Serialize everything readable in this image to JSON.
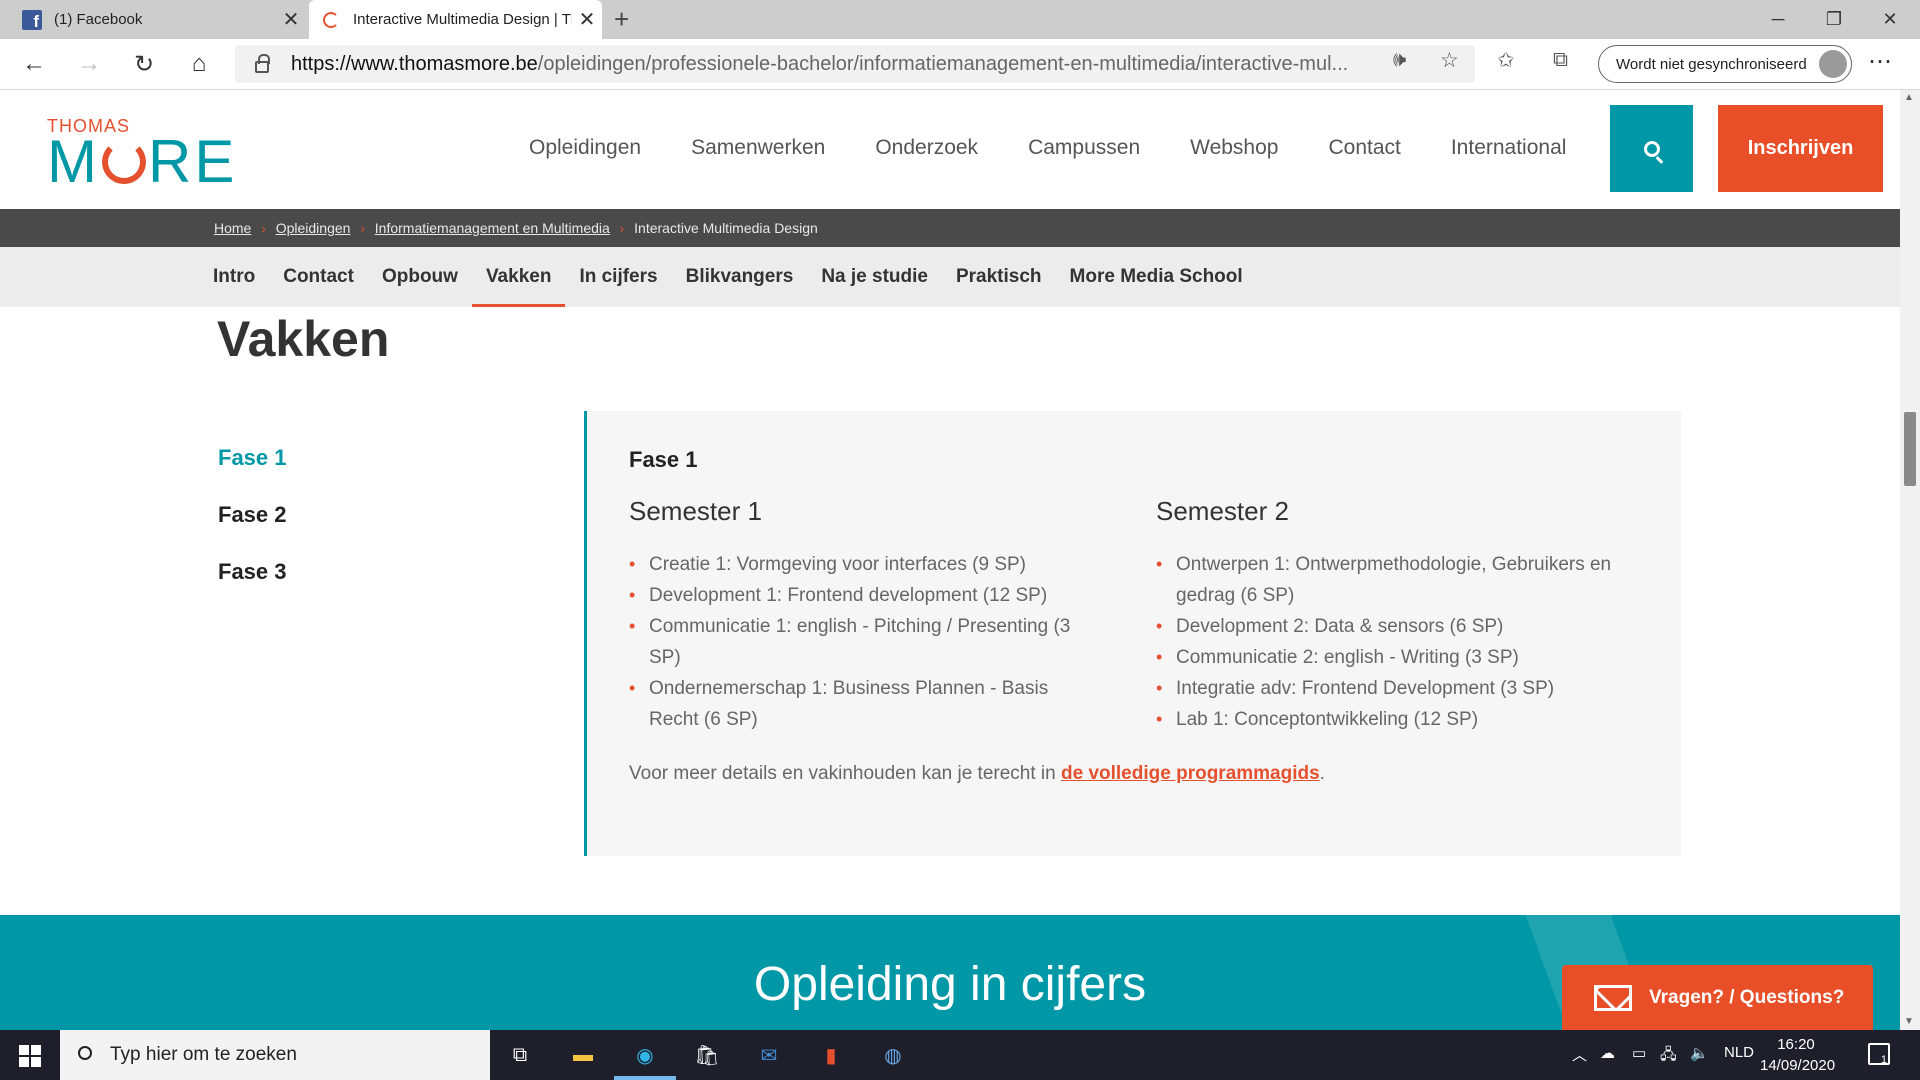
{
  "browser": {
    "tabs": [
      {
        "title": "(1) Facebook",
        "icon": "facebook-icon"
      },
      {
        "title": "Interactive Multimedia Design | Thomas More",
        "icon": "loading-icon"
      }
    ],
    "url_host": "https://www.thomasmore.be",
    "url_path": "/opleidingen/professionele-bachelor/informatiemanagement-en-multimedia/interactive-mul...",
    "sync_label": "Wordt niet gesynchroniseerd"
  },
  "site": {
    "logo_top": "THOMAS",
    "logo_bottom_1": "M",
    "logo_bottom_2": "RE",
    "nav": [
      "Opleidingen",
      "Samenwerken",
      "Onderzoek",
      "Campussen",
      "Webshop",
      "Contact",
      "International"
    ],
    "cta_label": "Inschrijven",
    "brand_teal": "#0098a6",
    "brand_orange": "#e84e27"
  },
  "breadcrumb": [
    "Home",
    "Opleidingen",
    "Informatiemanagement en Multimedia",
    "Interactive Multimedia Design"
  ],
  "subnav": [
    "Intro",
    "Contact",
    "Opbouw",
    "Vakken",
    "In cijfers",
    "Blikvangers",
    "Na je studie",
    "Praktisch",
    "More Media School"
  ],
  "subnav_active": "Vakken",
  "content": {
    "page_title": "Vakken",
    "fases": [
      "Fase 1",
      "Fase 2",
      "Fase 3"
    ],
    "active_fase": "Fase 1",
    "panel_title": "Fase 1",
    "semesters": [
      {
        "title": "Semester 1",
        "courses": [
          "Creatie 1: Vormgeving voor interfaces (9 SP)",
          "Development 1: Frontend development (12 SP)",
          "Communicatie 1: english - Pitching / Presenting (3 SP)",
          "Ondernemerschap 1: Business Plannen - Basis Recht (6 SP)"
        ]
      },
      {
        "title": "Semester 2",
        "courses": [
          "Ontwerpen 1: Ontwerpmethodologie, Gebruikers en gedrag (6 SP)",
          "Development 2: Data & sensors (6 SP)",
          "Communicatie 2: english - Writing (3 SP)",
          "Integratie adv: Frontend Development (3 SP)",
          "Lab 1: Conceptontwikkeling (12 SP)"
        ]
      }
    ],
    "note_prefix": "Voor meer details en vakinhouden kan je terecht in ",
    "note_link": "de volledige programmagids",
    "note_suffix": "."
  },
  "band_title": "Opleiding in cijfers",
  "questions_label": "Vragen? / Questions?",
  "taskbar": {
    "search_placeholder": "Typ hier om te zoeken",
    "language": "NLD",
    "time": "16:20",
    "date": "14/09/2020",
    "notification_count": "1"
  }
}
